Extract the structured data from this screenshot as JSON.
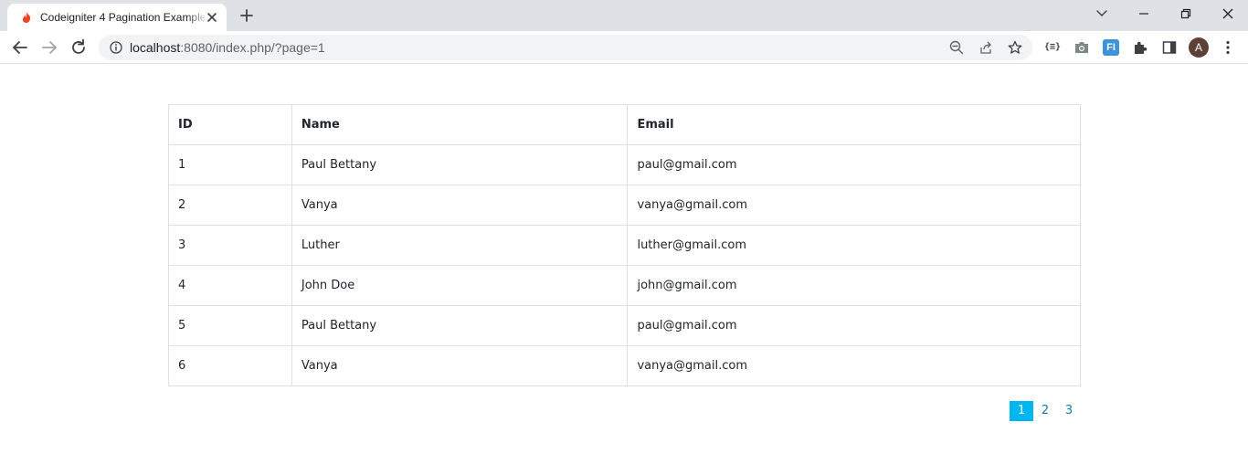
{
  "browser": {
    "tab_title": "Codeigniter 4 Pagination Example",
    "url_host": "localhost",
    "url_rest": ":8080/index.php/?page=1",
    "avatar_initial": "A",
    "ext_label": "{≡}",
    "ext_badge": "FI"
  },
  "table": {
    "headers": {
      "id": "ID",
      "name": "Name",
      "email": "Email"
    },
    "rows": [
      {
        "id": "1",
        "name": "Paul Bettany",
        "email": "paul@gmail.com"
      },
      {
        "id": "2",
        "name": "Vanya",
        "email": "vanya@gmail.com"
      },
      {
        "id": "3",
        "name": "Luther",
        "email": "luther@gmail.com"
      },
      {
        "id": "4",
        "name": "John Doe",
        "email": "john@gmail.com"
      },
      {
        "id": "5",
        "name": "Paul Bettany",
        "email": "paul@gmail.com"
      },
      {
        "id": "6",
        "name": "Vanya",
        "email": "vanya@gmail.com"
      }
    ]
  },
  "pagination": {
    "pages": [
      "1",
      "2",
      "3"
    ],
    "current": "1"
  },
  "colors": {
    "active_page": "#00b6f0",
    "link": "#0b7fab",
    "table_border": "#dee2e6"
  }
}
